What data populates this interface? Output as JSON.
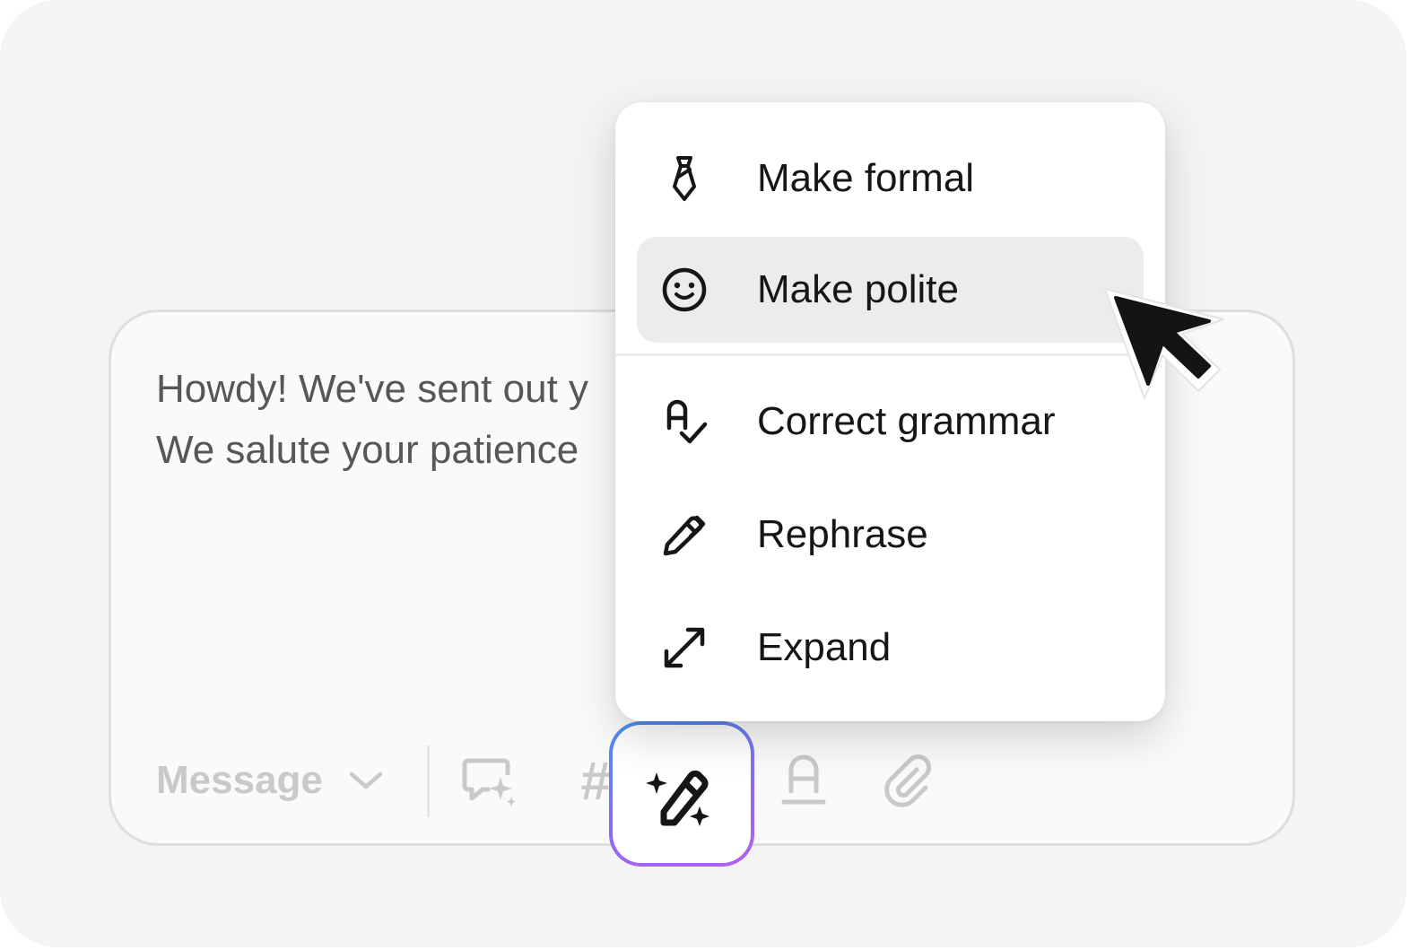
{
  "composer": {
    "text_lines": [
      "Howdy! We've sent out y",
      "We salute your patience"
    ]
  },
  "toolbar": {
    "message_select_label": "Message",
    "hash_symbol": "#",
    "icons": [
      "chat-sparkle-icon",
      "hash-icon",
      "ai-rewrite-icon",
      "text-format-icon",
      "paperclip-icon"
    ]
  },
  "menu": {
    "items": [
      {
        "label": "Make formal",
        "icon": "tie-icon"
      },
      {
        "label": "Make polite",
        "icon": "smiley-icon",
        "active": true
      },
      {
        "label": "Correct grammar",
        "icon": "spellcheck-icon"
      },
      {
        "label": "Rephrase",
        "icon": "pencil-icon"
      },
      {
        "label": "Expand",
        "icon": "expand-arrows-icon"
      }
    ]
  },
  "colors": {
    "background": "#f4f4f4",
    "menu_active": "#ececec",
    "ai_gradient_start": "#4a90f0",
    "ai_gradient_end": "#b45ff0",
    "toolbar_icon": "#c9c9c9"
  }
}
